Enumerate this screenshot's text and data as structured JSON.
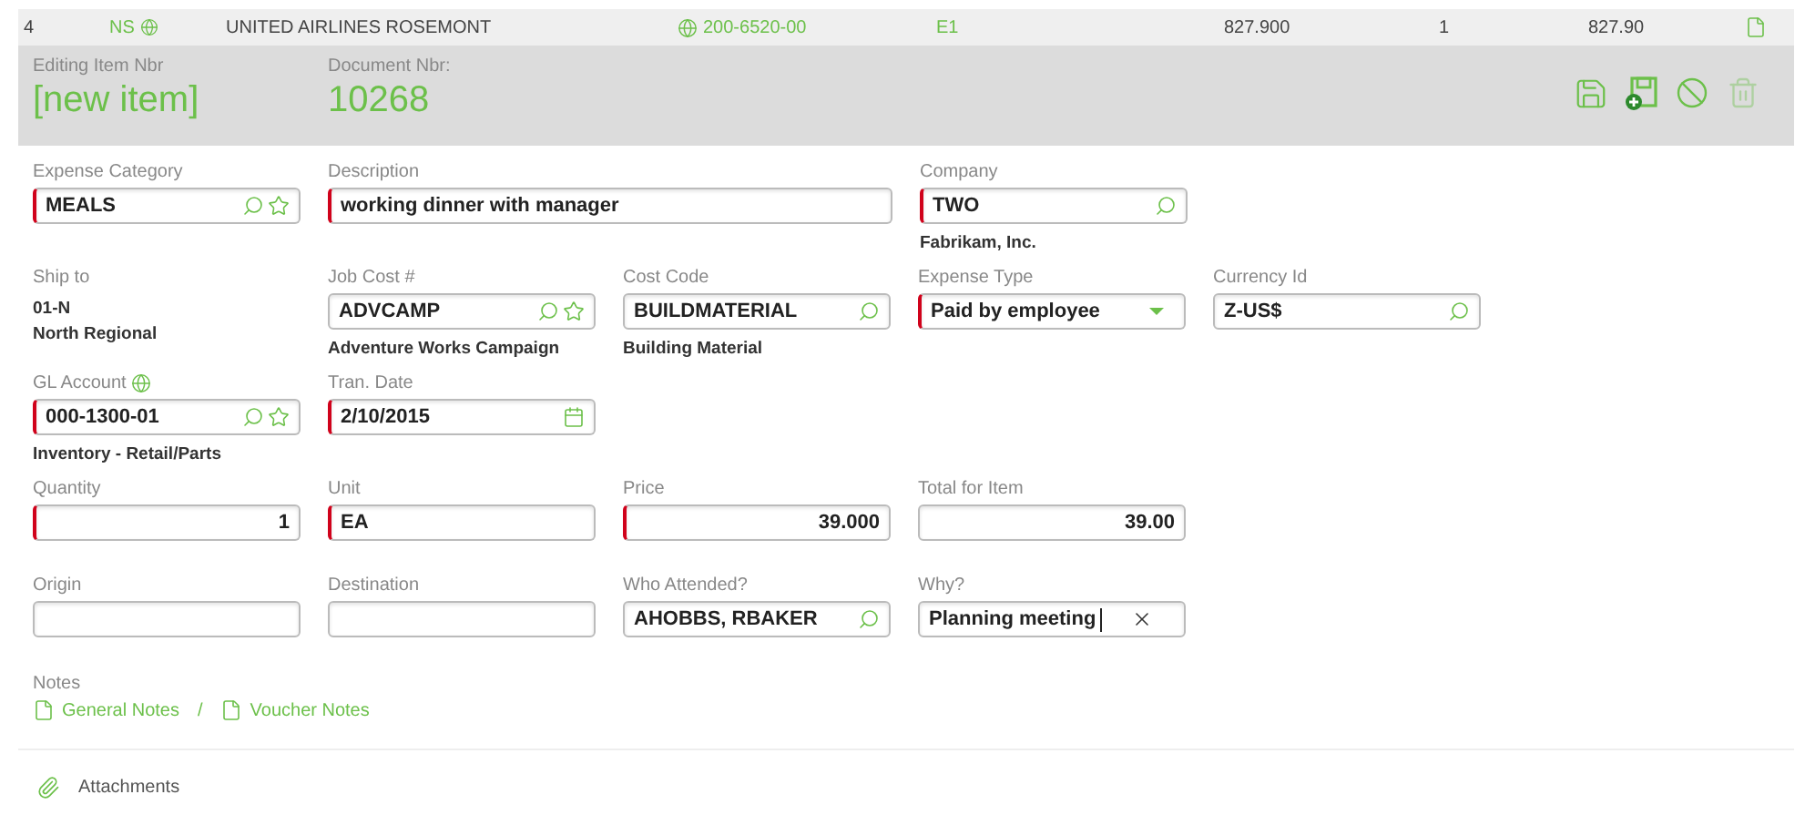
{
  "line_item": {
    "cells": [
      {
        "text": "4",
        "kind": "plain"
      },
      {
        "text": "NS",
        "kind": "type"
      },
      {
        "text": "UNITED AIRLINES ROSEMONT",
        "kind": "plain"
      },
      {
        "text": "200-6520-00",
        "kind": "account"
      },
      {
        "text": "E1",
        "kind": "code"
      },
      {
        "text": "827.900",
        "kind": "plain"
      },
      {
        "text": "1",
        "kind": "plain"
      },
      {
        "text": "827.90",
        "kind": "plain"
      }
    ]
  },
  "header": {
    "fields": [
      {
        "label": "Editing Item Nbr",
        "value": "[new item]"
      },
      {
        "label": "Document Nbr:",
        "value": "10268"
      }
    ],
    "toolbar": [
      {
        "kind": "save",
        "disabled": false
      },
      {
        "kind": "save_new",
        "disabled": false
      },
      {
        "kind": "cancel",
        "disabled": false
      },
      {
        "kind": "delete",
        "disabled": true
      }
    ]
  },
  "form": {
    "rows": [
      [
        {
          "label": "Expense Category",
          "kind": "lookup_fav",
          "value": "MEALS",
          "required": true
        },
        {
          "label": "Description",
          "kind": "text_wide",
          "value": "working dinner with manager",
          "required": true
        },
        "",
        {
          "label": "Company",
          "kind": "lookup",
          "value": "TWO",
          "required": true,
          "sub": "Fabrikam, Inc."
        }
      ],
      [
        {
          "label": "Ship to",
          "kind": "static",
          "value": "01-N",
          "sub": "North Regional"
        },
        {
          "label": "Job Cost #",
          "kind": "lookup_fav",
          "value": "ADVCAMP",
          "required": false,
          "sub": "Adventure Works Campaign"
        },
        {
          "label": "Cost Code",
          "kind": "lookup",
          "value": "BUILDMATERIAL",
          "required": false,
          "sub": "Building Material"
        },
        {
          "label": "Expense Type",
          "kind": "select",
          "value": "Paid by employee",
          "required": true
        },
        {
          "label": "Currency Id",
          "kind": "lookup",
          "value": "Z-US$",
          "required": false
        }
      ],
      [
        {
          "label": "GL Account",
          "kind": "lookup_fav",
          "value": "000-1300-01",
          "required": true,
          "sub": "Inventory - Retail/Parts",
          "label_icon": true
        },
        {
          "label": "Tran. Date",
          "kind": "date",
          "value": "2/10/2015",
          "required": true
        }
      ],
      [
        {
          "label": "Quantity",
          "kind": "number",
          "value": "1",
          "required": true
        },
        {
          "label": "Unit",
          "kind": "text",
          "value": "EA",
          "required": true
        },
        {
          "label": "Price",
          "kind": "number",
          "value": "39.000",
          "required": true
        },
        {
          "label": "Total for Item",
          "kind": "number",
          "value": "39.00",
          "required": false
        }
      ],
      [
        {
          "label": "Origin",
          "kind": "text",
          "required": false
        },
        {
          "label": "Destination",
          "kind": "text",
          "required": false
        },
        {
          "label": "Who Attended?",
          "kind": "lookup",
          "value": "AHOBBS, RBAKER",
          "required": false
        },
        {
          "label": "Why?",
          "kind": "clearable",
          "value": "Planning meeting",
          "required": false
        }
      ]
    ]
  },
  "notes": {
    "label": "Notes",
    "links": [
      "General Notes",
      "Voucher Notes"
    ],
    "separator": "/"
  },
  "attachments": {
    "label": "Attachments"
  }
}
